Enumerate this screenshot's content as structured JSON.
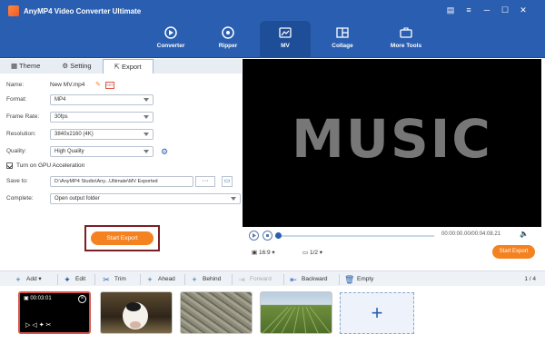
{
  "app": {
    "title": "AnyMP4 Video Converter Ultimate"
  },
  "nav": [
    {
      "label": "Converter",
      "icon": "converter-icon"
    },
    {
      "label": "Ripper",
      "icon": "ripper-icon"
    },
    {
      "label": "MV",
      "icon": "mv-icon",
      "active": true
    },
    {
      "label": "Collage",
      "icon": "collage-icon"
    },
    {
      "label": "More Tools",
      "icon": "toolbox-icon"
    }
  ],
  "tabs": {
    "theme": "Theme",
    "setting": "Setting",
    "export": "Export"
  },
  "form": {
    "name_label": "Name:",
    "name_value": "New MV.mp4",
    "format_label": "Format:",
    "format_value": "MP4",
    "framerate_label": "Frame Rate:",
    "framerate_value": "30fps",
    "resolution_label": "Resolution:",
    "resolution_value": "3840x2160 (4K)",
    "quality_label": "Quality:",
    "quality_value": "High Quality",
    "gpu_label": "Turn on GPU Acceleration",
    "saveto_label": "Save to:",
    "saveto_value": "D:\\AnyMP4 Studio\\Any...Ultimate\\MV Exported",
    "complete_label": "Complete:",
    "complete_value": "Open output folder",
    "start_export": "Start Export"
  },
  "preview": {
    "text": "MUSIC"
  },
  "player": {
    "time": "00:00:00.00/00:04:08.21",
    "ratio": "16:9",
    "page": "1/2",
    "start_export": "Start Export"
  },
  "toolbar": {
    "add": "Add",
    "edit": "Edit",
    "trim": "Trim",
    "ahead": "Ahead",
    "behind": "Behind",
    "forward": "Forward",
    "backward": "Backward",
    "empty": "Empty",
    "pager": "1 / 4"
  },
  "timeline": {
    "first_clip_time": "00:03:01"
  },
  "colors": {
    "brand_blue": "#2a5eb0",
    "accent_orange": "#f58220",
    "highlight_red": "#7a1e25"
  }
}
